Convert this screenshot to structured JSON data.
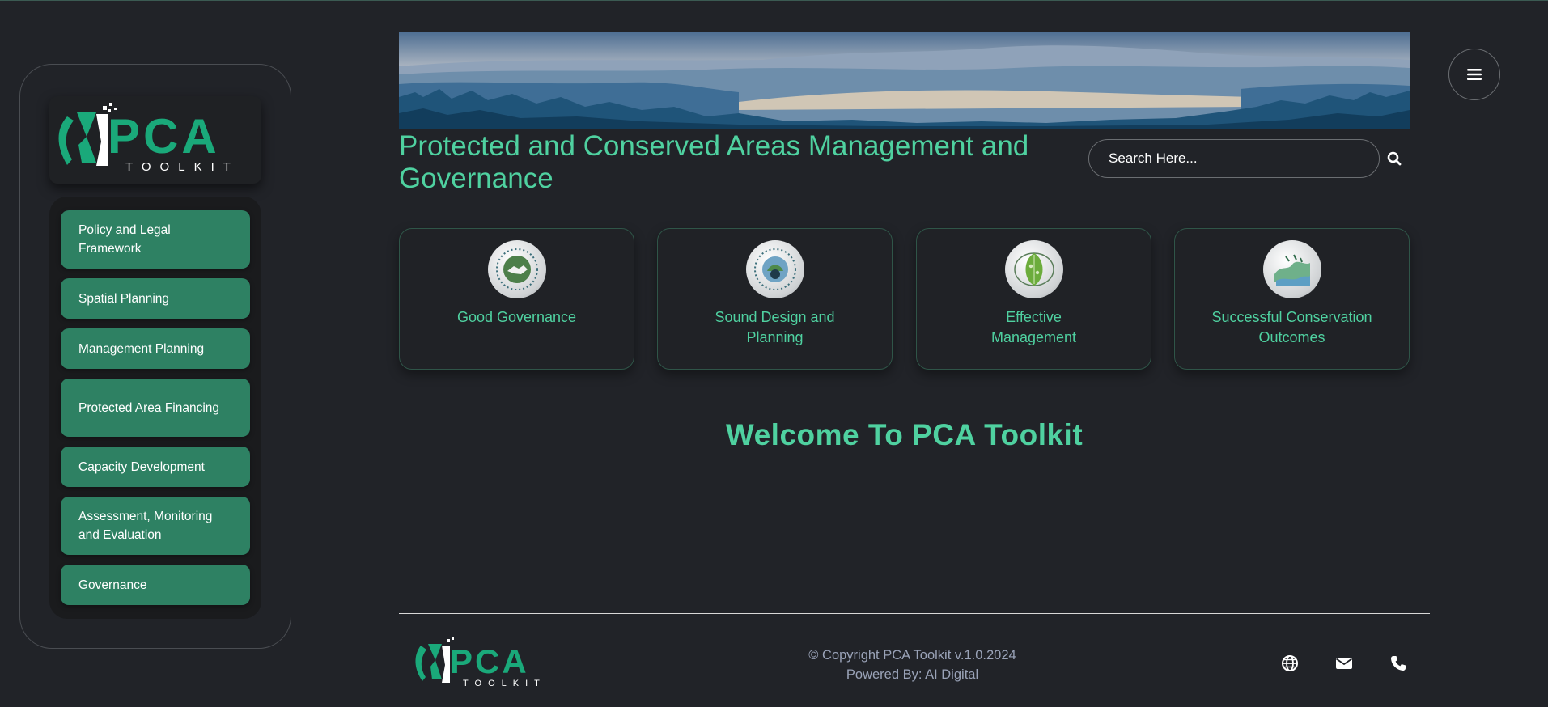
{
  "logo": {
    "brand": "PCA",
    "sub": "TOOLKIT"
  },
  "sidebar": {
    "items": [
      {
        "label": "Policy and Legal Framework"
      },
      {
        "label": "Spatial Planning"
      },
      {
        "label": "Management Planning"
      },
      {
        "label": "Protected Area Financing"
      },
      {
        "label": "Capacity Development"
      },
      {
        "label": "Assessment, Monitoring and Evaluation"
      },
      {
        "label": "Governance"
      }
    ]
  },
  "header": {
    "title": "Protected and Conserved Areas Management and Governance",
    "search_placeholder": "Search Here...",
    "menu_icon": "hamburger-icon",
    "search_icon": "search-icon"
  },
  "cards": [
    {
      "label": "Good Governance",
      "icon": "handshake-emblem"
    },
    {
      "label": "Sound Design and Planning",
      "icon": "design-planning-emblem"
    },
    {
      "label": "Effective Management",
      "icon": "leaf-globe-emblem"
    },
    {
      "label": "Successful Conservation Outcomes",
      "icon": "landscape-emblem"
    }
  ],
  "welcome": "Welcome To PCA Toolkit",
  "footer": {
    "copyright": "© Copyright PCA Toolkit v.1.0.2024",
    "powered": "Powered By: AI Digital",
    "icons": [
      "globe-icon",
      "mail-icon",
      "phone-icon"
    ]
  },
  "colors": {
    "accent": "#4fd1a0",
    "button": "#2e8163",
    "background": "#212328"
  }
}
